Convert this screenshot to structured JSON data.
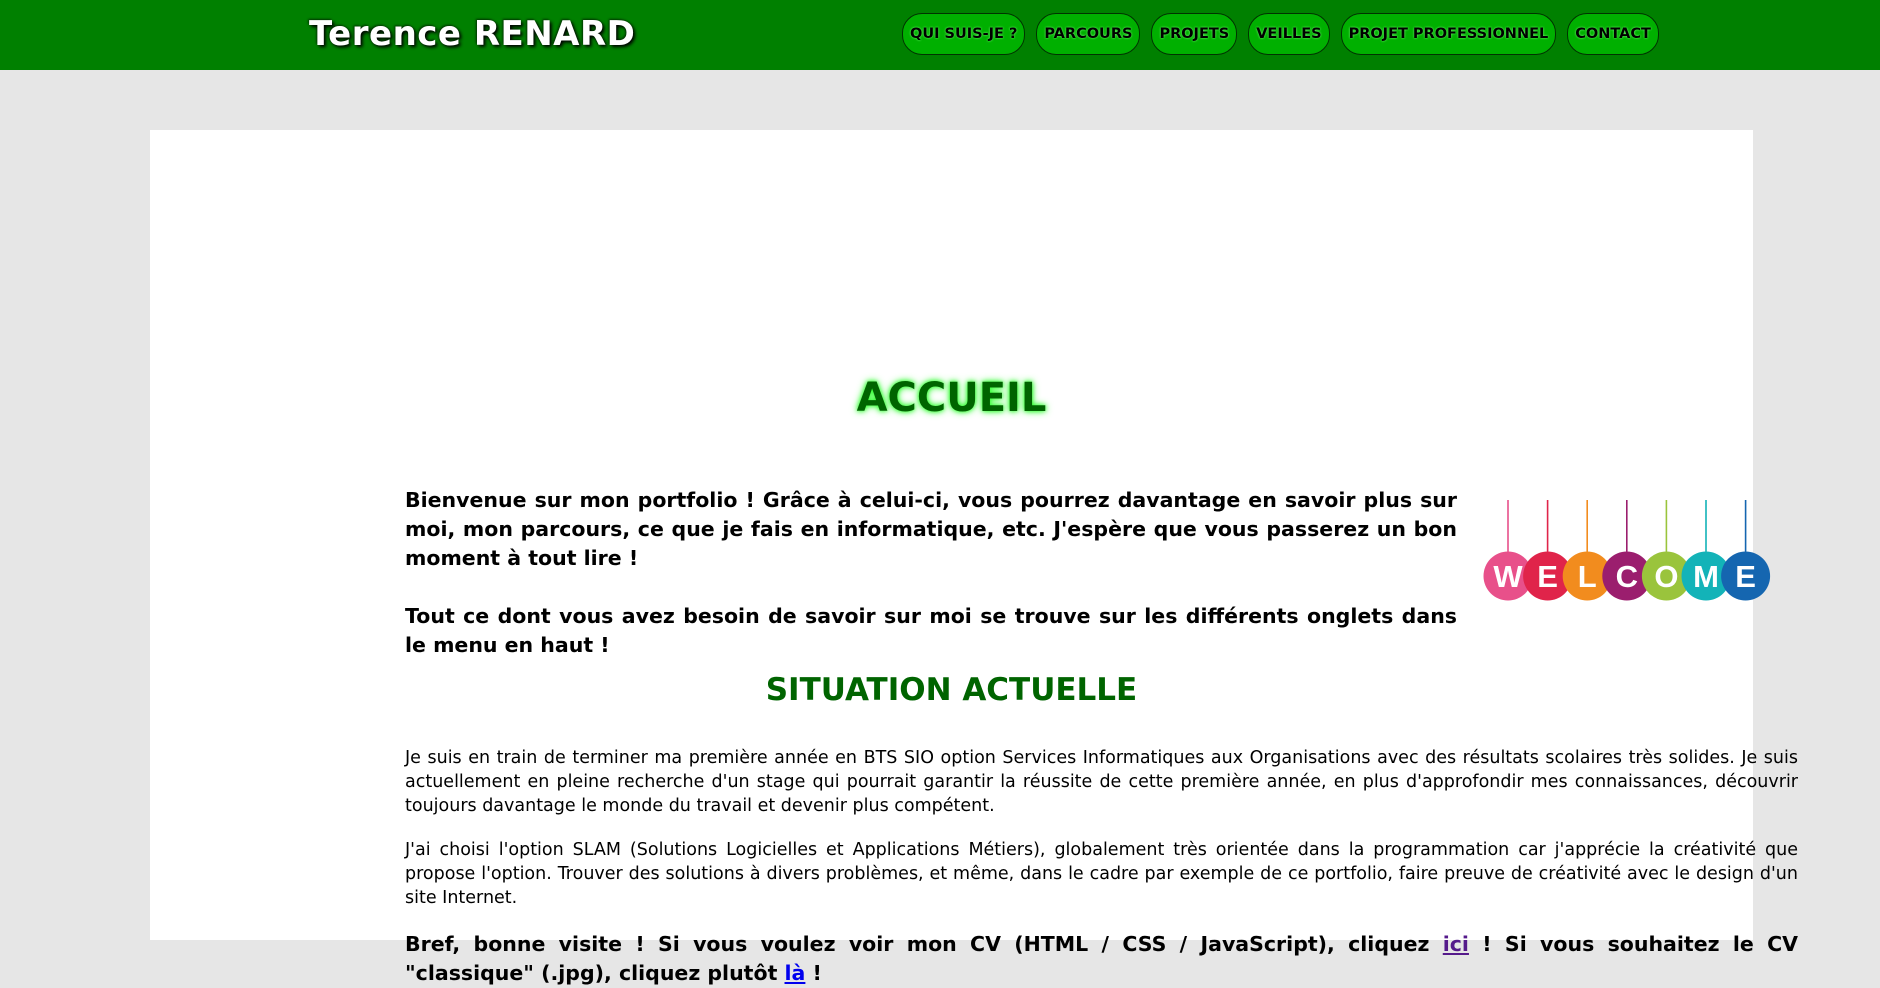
{
  "header": {
    "site_title": "Terence RENARD",
    "nav": [
      {
        "label": "QUI SUIS-JE ?"
      },
      {
        "label": "PARCOURS"
      },
      {
        "label": "PROJETS"
      },
      {
        "label": "VEILLES"
      },
      {
        "label": "PROJET PROFESSIONNEL"
      },
      {
        "label": "CONTACT"
      }
    ]
  },
  "main": {
    "title": "ACCUEIL",
    "intro": [
      "Bienvenue sur mon portfolio ! Grâce à celui-ci, vous pourrez davantage en savoir plus sur moi, mon parcours, ce que je fais en informatique, etc. J'espère que vous passerez un bon moment à tout lire !",
      "Tout ce dont vous avez besoin de savoir sur moi se trouve sur les différents onglets dans le menu en haut !"
    ],
    "welcome_image": {
      "letters": [
        "W",
        "E",
        "L",
        "C",
        "O",
        "M",
        "E"
      ],
      "colors": [
        "#e8508a",
        "#e0244a",
        "#f28c1e",
        "#9b1e6e",
        "#9ac43c",
        "#13b3b8",
        "#1566b0"
      ]
    },
    "situation_title": "SITUATION ACTUELLE",
    "situation_p1": "Je suis en train de terminer ma première année en BTS SIO option Services Informatiques aux Organisations avec des résultats scolaires très solides. Je suis actuellement en pleine recherche d'un stage qui pourrait garantir la réussite de cette première année, en plus d'approfondir mes connaissances, découvrir toujours davantage le monde du travail et devenir plus compétent.",
    "situation_p2": "J'ai choisi l'option SLAM (Solutions Logicielles et Applications Métiers), globalement très orientée dans la programmation car j'apprécie la créativité que propose l'option. Trouver des solutions à divers problèmes, et même, dans le cadre par exemple de ce portfolio, faire preuve de créativité avec le design d'un site Internet.",
    "closing": {
      "part1": "Bref, bonne visite ! Si vous voulez voir mon CV (HTML / CSS / JavaScript), cliquez ",
      "link1": "ici",
      "part2": " ! Si vous souhaitez le CV \"classique\" (.jpg), cliquez plutôt ",
      "link2": "là",
      "part3": " !"
    }
  },
  "colors": {
    "header_bg": "#008000",
    "nav_button_bg": "#00b000",
    "heading": "#006400",
    "page_bg": "#e6e6e6",
    "card_bg": "#ffffff"
  }
}
